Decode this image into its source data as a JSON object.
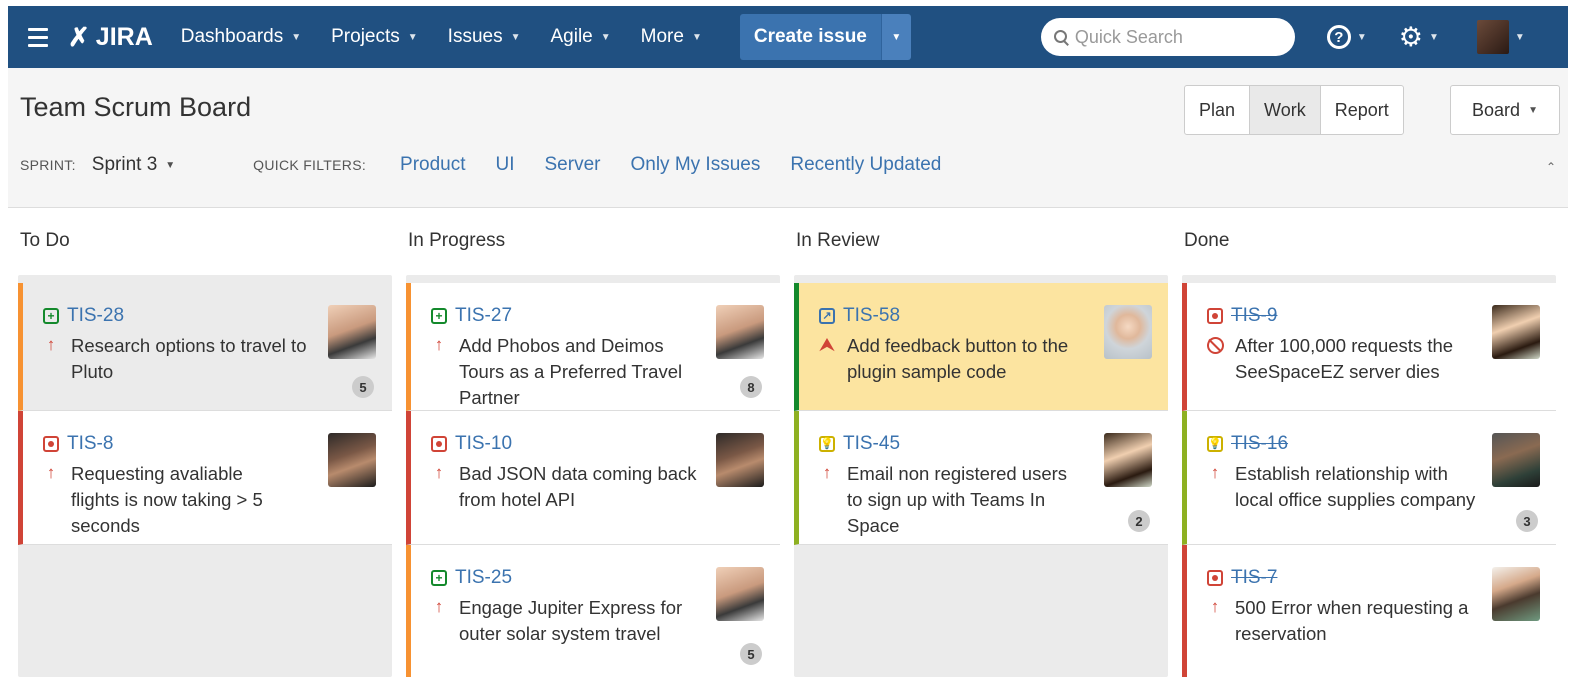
{
  "nav": {
    "logo": "JIRA",
    "items": [
      {
        "label": "Dashboards"
      },
      {
        "label": "Projects"
      },
      {
        "label": "Issues"
      },
      {
        "label": "Agile"
      },
      {
        "label": "More"
      }
    ],
    "create_label": "Create issue",
    "search_placeholder": "Quick Search",
    "help_icon": "?"
  },
  "header": {
    "title": "Team Scrum Board",
    "views": [
      "Plan",
      "Work",
      "Report"
    ],
    "active_view": "Work",
    "board_label": "Board",
    "sprint_label": "SPRINT:",
    "sprint_value": "Sprint 3",
    "quick_filters_label": "QUICK FILTERS:",
    "quick_filters": [
      "Product",
      "UI",
      "Server",
      "Only My Issues",
      "Recently Updated"
    ]
  },
  "columns": [
    {
      "title": "To Do",
      "cards": [
        {
          "key": "TIS-28",
          "type": "story",
          "priority": "high",
          "summary": "Research options to travel to Pluto",
          "count": "5",
          "accent": "#f79232"
        },
        {
          "key": "TIS-8",
          "type": "bug",
          "priority": "high",
          "summary": "Requesting avaliable flights is now taking > 5 seconds",
          "count": "",
          "accent": "#d04437"
        }
      ]
    },
    {
      "title": "In Progress",
      "cards": [
        {
          "key": "TIS-27",
          "type": "story",
          "priority": "high",
          "summary": "Add Phobos and Deimos Tours as a Preferred Travel Partner",
          "count": "8",
          "accent": "#f79232"
        },
        {
          "key": "TIS-10",
          "type": "bug",
          "priority": "high",
          "summary": "Bad JSON data coming back from hotel API",
          "count": "",
          "accent": "#d04437"
        },
        {
          "key": "TIS-25",
          "type": "story",
          "priority": "high",
          "summary": "Engage Jupiter Express for outer solar system travel",
          "count": "5",
          "accent": "#f79232"
        }
      ]
    },
    {
      "title": "In Review",
      "cards": [
        {
          "key": "TIS-58",
          "type": "improvement",
          "priority": "highest",
          "summary": "Add feedback button to the plugin sample code",
          "count": "",
          "accent": "#14892c"
        },
        {
          "key": "TIS-45",
          "type": "idea",
          "priority": "high",
          "summary": "Email non registered users to sign up with Teams In Space",
          "count": "2",
          "accent": "#8eb021"
        }
      ]
    },
    {
      "title": "Done",
      "cards": [
        {
          "key": "TIS-9",
          "type": "bug",
          "priority": "blocker",
          "summary": "After 100,000 requests the SeeSpaceEZ server dies",
          "count": "",
          "accent": "#d04437"
        },
        {
          "key": "TIS-16",
          "type": "idea",
          "priority": "high",
          "summary": "Establish relationship with local office supplies company",
          "count": "3",
          "accent": "#8eb021"
        },
        {
          "key": "TIS-7",
          "type": "bug",
          "priority": "high",
          "summary": "500 Error when requesting a reservation",
          "count": "",
          "accent": "#d04437"
        }
      ]
    }
  ]
}
